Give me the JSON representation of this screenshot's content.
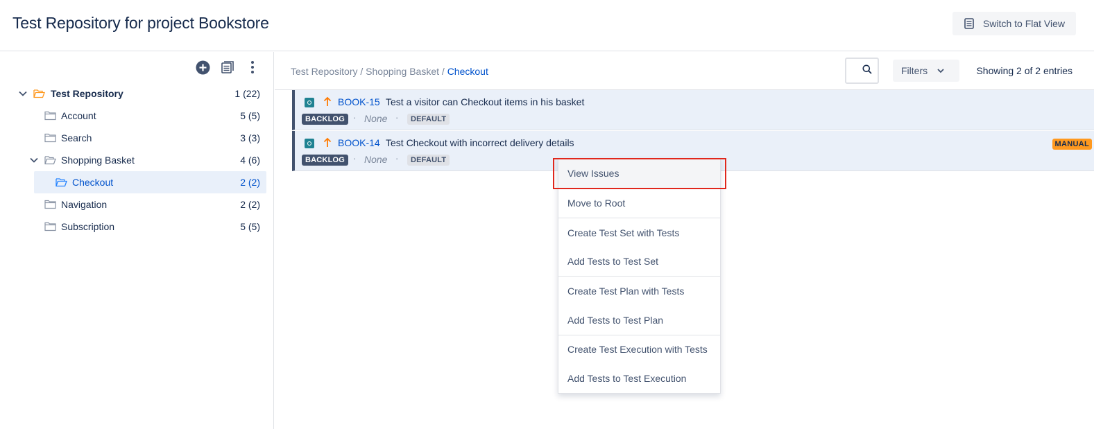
{
  "header": {
    "title": "Test Repository for project Bookstore",
    "flat_view_label": "Switch to Flat View"
  },
  "toolbar_icons": [
    "add-folder-icon",
    "document-icon",
    "more-options-icon"
  ],
  "tree": [
    {
      "label": "Test Repository",
      "count": "1 (22)",
      "expanded": true,
      "bold": true
    },
    {
      "label": "Account",
      "count": "5 (5)"
    },
    {
      "label": "Search",
      "count": "3 (3)"
    },
    {
      "label": "Shopping Basket",
      "count": "4 (6)",
      "expanded": true
    },
    {
      "label": "Checkout",
      "count": "2 (2)",
      "selected": true
    },
    {
      "label": "Navigation",
      "count": "2 (2)"
    },
    {
      "label": "Subscription",
      "count": "5 (5)"
    }
  ],
  "breadcrumb": {
    "part1": "Test Repository",
    "sep": " / ",
    "part2": "Shopping Basket",
    "current": "Checkout"
  },
  "filters_label": "Filters",
  "showing_text": "Showing 2 of 2 entries",
  "issues": [
    {
      "key": "BOOK-15",
      "summary": "Test a visitor can Checkout items in his basket",
      "status": "BACKLOG",
      "none": "None",
      "dot": "·",
      "label": "DEFAULT",
      "test_type": ""
    },
    {
      "key": "BOOK-14",
      "summary": "Test Checkout with incorrect delivery details",
      "status": "BACKLOG",
      "none": "None",
      "dot": "·",
      "label": "DEFAULT",
      "test_type": "MANUAL"
    }
  ],
  "context_menu": [
    "View Issues",
    "Move to Root",
    "Create Test Set with Tests",
    "Add Tests to Test Set",
    "Create Test Plan with Tests",
    "Add Tests to Test Plan",
    "Create Test Execution with Tests",
    "Add Tests to Test Execution"
  ],
  "colors": {
    "accent": "#0052cc",
    "selected_bg": "#e9f0fa",
    "issue_row_bg": "#eaf0f9",
    "status_bg": "#42526e",
    "manual_badge": "#ff991f",
    "highlight": "#e0271c",
    "priority_arrow": "#ff7a00"
  }
}
